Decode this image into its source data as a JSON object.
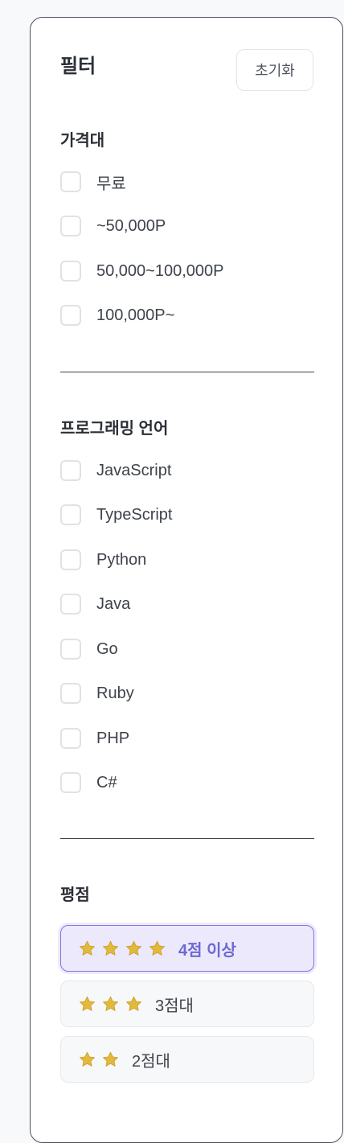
{
  "filter": {
    "title": "필터",
    "reset_label": "초기화"
  },
  "price": {
    "title": "가격대",
    "options": [
      "무료",
      "~50,000P",
      "50,000~100,000P",
      "100,000P~"
    ]
  },
  "languages": {
    "title": "프로그래밍 언어",
    "options": [
      "JavaScript",
      "TypeScript",
      "Python",
      "Java",
      "Go",
      "Ruby",
      "PHP",
      "C#"
    ]
  },
  "rating": {
    "title": "평점",
    "options": [
      {
        "label": "4점 이상",
        "stars": 4,
        "selected": true
      },
      {
        "label": "3점대",
        "stars": 3,
        "selected": false
      },
      {
        "label": "2점대",
        "stars": 2,
        "selected": false
      }
    ]
  },
  "colors": {
    "accent": "#6f68d4",
    "star": "#e2b93b"
  }
}
